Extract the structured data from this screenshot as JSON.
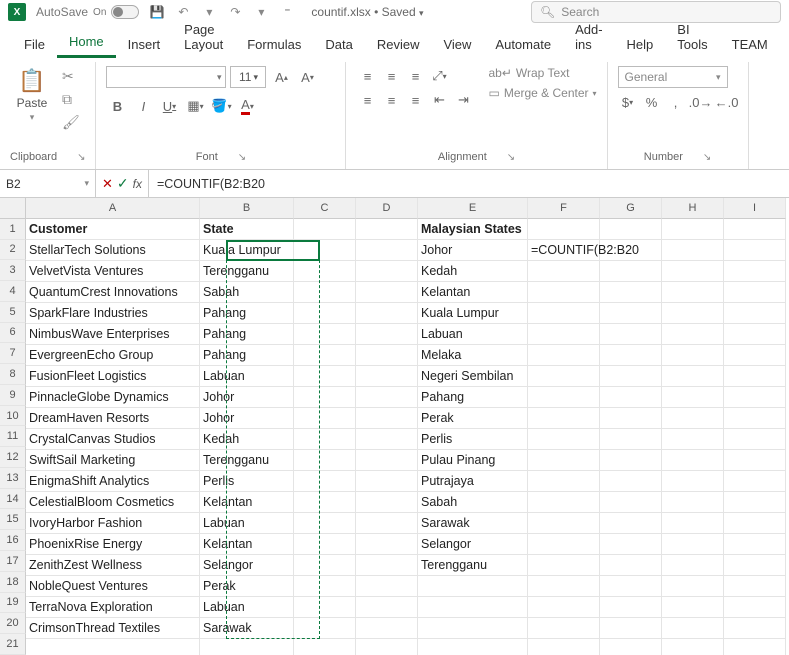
{
  "titlebar": {
    "autosave_label": "AutoSave",
    "autosave_state": "On",
    "filename": "countif.xlsx",
    "saved_status": "Saved",
    "search_placeholder": "Search"
  },
  "tabs": [
    "File",
    "Home",
    "Insert",
    "Page Layout",
    "Formulas",
    "Data",
    "Review",
    "View",
    "Automate",
    "Add-ins",
    "Help",
    "BI Tools",
    "TEAM"
  ],
  "active_tab": "Home",
  "ribbon": {
    "clipboard": {
      "paste": "Paste",
      "label": "Clipboard"
    },
    "font": {
      "label": "Font",
      "size": "11",
      "bold": "B",
      "italic": "I",
      "underline": "U"
    },
    "alignment": {
      "label": "Alignment",
      "wrap": "Wrap Text",
      "merge": "Merge & Center"
    },
    "number": {
      "label": "Number",
      "format": "General"
    }
  },
  "namebox": "B2",
  "formula": "=COUNTIF(B2:B20",
  "columns": [
    "A",
    "B",
    "C",
    "D",
    "E",
    "F",
    "G",
    "H",
    "I"
  ],
  "rows": 21,
  "headers": {
    "A": "Customer",
    "B": "State",
    "E": "Malaysian States"
  },
  "sheet": {
    "A": [
      "StellarTech Solutions",
      "VelvetVista Ventures",
      "QuantumCrest Innovations",
      "SparkFlare Industries",
      "NimbusWave Enterprises",
      "EvergreenEcho Group",
      "FusionFleet Logistics",
      "PinnacleGlobe Dynamics",
      "DreamHaven Resorts",
      "CrystalCanvas Studios",
      "SwiftSail Marketing",
      "EnigmaShift Analytics",
      "CelestialBloom Cosmetics",
      "IvoryHarbor Fashion",
      "PhoenixRise Energy",
      "ZenithZest Wellness",
      "NobleQuest Ventures",
      "TerraNova Exploration",
      "CrimsonThread Textiles"
    ],
    "B": [
      "Kuala Lumpur",
      "Terengganu",
      "Sabah",
      "Pahang",
      "Pahang",
      "Pahang",
      "Labuan",
      "Johor",
      "Johor",
      "Kedah",
      "Terengganu",
      "Perlis",
      "Kelantan",
      "Labuan",
      "Kelantan",
      "Selangor",
      "Perak",
      "Labuan",
      "Sarawak"
    ],
    "E": [
      "Johor",
      "Kedah",
      "Kelantan",
      "Kuala Lumpur",
      "Labuan",
      "Melaka",
      "Negeri Sembilan",
      "Pahang",
      "Perak",
      "Perlis",
      "Pulau Pinang",
      "Putrajaya",
      "Sabah",
      "Sarawak",
      "Selangor",
      "Terengganu"
    ],
    "F2": "=COUNTIF(B2:B20"
  }
}
